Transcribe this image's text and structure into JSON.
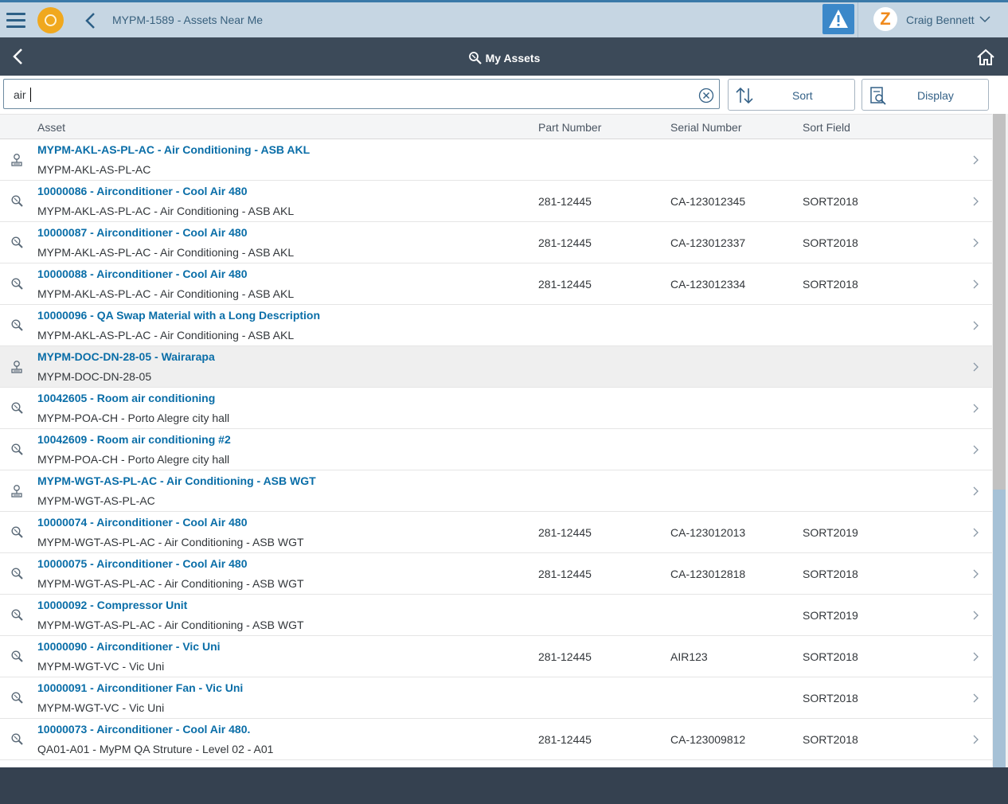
{
  "topbar": {
    "title": "MYPM-1589 - Assets Near Me",
    "user_initial": "Z",
    "user_name": "Craig Bennett",
    "alert_icon": "warning-icon"
  },
  "shellbar": {
    "title": "My Assets",
    "title_icon": "search-asset-icon",
    "home_icon": "home-icon"
  },
  "search": {
    "value": "air"
  },
  "toolbar": {
    "sort_label": "Sort",
    "display_label": "Display"
  },
  "columns": {
    "asset": "Asset",
    "part_number": "Part Number",
    "serial_number": "Serial Number",
    "sort_field": "Sort Field"
  },
  "rows": [
    {
      "icon": "location-icon",
      "title": "MYPM-AKL-AS-PL-AC - Air Conditioning - ASB AKL",
      "sub": "MYPM-AKL-AS-PL-AC",
      "part": "",
      "serial": "",
      "sort": ""
    },
    {
      "icon": "asset-search-icon",
      "title": "10000086 - Airconditioner - Cool Air 480",
      "sub": "MYPM-AKL-AS-PL-AC - Air Conditioning - ASB AKL",
      "part": "281-12445",
      "serial": "CA-123012345",
      "sort": "SORT2018"
    },
    {
      "icon": "asset-search-icon",
      "title": "10000087 - Airconditioner - Cool Air 480",
      "sub": "MYPM-AKL-AS-PL-AC - Air Conditioning - ASB AKL",
      "part": "281-12445",
      "serial": "CA-123012337",
      "sort": "SORT2018"
    },
    {
      "icon": "asset-search-icon",
      "title": "10000088 - Airconditioner - Cool Air 480",
      "sub": "MYPM-AKL-AS-PL-AC - Air Conditioning - ASB AKL",
      "part": "281-12445",
      "serial": "CA-123012334",
      "sort": "SORT2018"
    },
    {
      "icon": "asset-search-icon",
      "title": "10000096 - QA Swap Material with a Long Description",
      "sub": "MYPM-AKL-AS-PL-AC - Air Conditioning - ASB AKL",
      "part": "",
      "serial": "",
      "sort": ""
    },
    {
      "icon": "location-icon",
      "title": "MYPM-DOC-DN-28-05 - Wairarapa",
      "sub": "MYPM-DOC-DN-28-05",
      "part": "",
      "serial": "",
      "sort": "",
      "selected": true
    },
    {
      "icon": "asset-search-icon",
      "title": "10042605 - Room air conditioning",
      "sub": "MYPM-POA-CH - Porto Alegre city hall",
      "part": "",
      "serial": "",
      "sort": ""
    },
    {
      "icon": "asset-search-icon",
      "title": "10042609 - Room air conditioning #2",
      "sub": "MYPM-POA-CH - Porto Alegre city hall",
      "part": "",
      "serial": "",
      "sort": ""
    },
    {
      "icon": "location-icon",
      "title": "MYPM-WGT-AS-PL-AC - Air Conditioning - ASB WGT",
      "sub": "MYPM-WGT-AS-PL-AC",
      "part": "",
      "serial": "",
      "sort": ""
    },
    {
      "icon": "asset-search-icon",
      "title": "10000074 - Airconditioner - Cool Air 480",
      "sub": "MYPM-WGT-AS-PL-AC - Air Conditioning - ASB WGT",
      "part": "281-12445",
      "serial": "CA-123012013",
      "sort": "SORT2019"
    },
    {
      "icon": "asset-search-icon",
      "title": "10000075 - Airconditioner - Cool Air 480",
      "sub": "MYPM-WGT-AS-PL-AC - Air Conditioning - ASB WGT",
      "part": "281-12445",
      "serial": "CA-123012818",
      "sort": "SORT2018"
    },
    {
      "icon": "asset-search-icon",
      "title": "10000092 - Compressor Unit",
      "sub": "MYPM-WGT-AS-PL-AC - Air Conditioning - ASB WGT",
      "part": "",
      "serial": "",
      "sort": "SORT2019"
    },
    {
      "icon": "asset-search-icon",
      "title": "10000090 - Airconditioner - Vic Uni",
      "sub": "MYPM-WGT-VC - Vic Uni",
      "part": "281-12445",
      "serial": "AIR123",
      "sort": "SORT2018"
    },
    {
      "icon": "asset-search-icon",
      "title": "10000091 - Airconditioner Fan - Vic Uni",
      "sub": "MYPM-WGT-VC - Vic Uni",
      "part": "",
      "serial": "",
      "sort": "SORT2018"
    },
    {
      "icon": "asset-search-icon",
      "title": "10000073 - Airconditioner - Cool Air 480.",
      "sub": "QA01-A01 - MyPM QA Struture - Level 02 - A01",
      "part": "281-12445",
      "serial": "CA-123009812",
      "sort": "SORT2018"
    }
  ],
  "colors": {
    "topbar": "#c6d6e3",
    "shellbar": "#3c4a59",
    "link": "#0a6ea8",
    "accent_orange": "#f0a81e",
    "alert_blue": "#3b88c9",
    "footer": "#354150"
  }
}
